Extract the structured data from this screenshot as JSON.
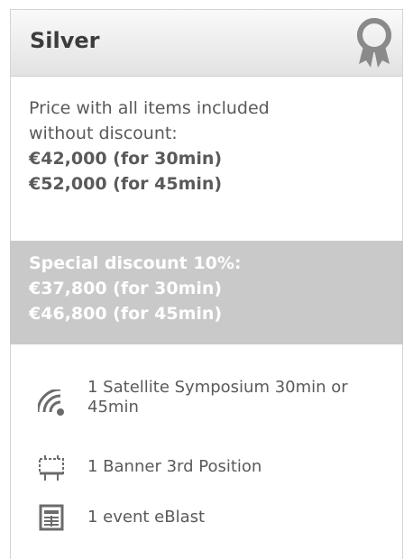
{
  "card": {
    "title": "Silver",
    "badge_icon": "award-ribbon-icon"
  },
  "price": {
    "line1": "Price with all items included",
    "line2": "without discount:",
    "price_30": "€42,000 (for 30min)",
    "price_45": "€52,000 (for 45min)"
  },
  "discount": {
    "heading": "Special discount 10%:",
    "price_30": "€37,800 (for 30min)",
    "price_45": "€46,800 (for 45min)"
  },
  "features": [
    {
      "icon": "wifi-signal-icon",
      "text": "1 Satellite Symposium 30min or 45min"
    },
    {
      "icon": "billboard-icon",
      "text": "1 Banner 3rd Position"
    },
    {
      "icon": "newsletter-icon",
      "text": "1 event eBlast"
    }
  ],
  "colors": {
    "header_bg": "#e6e6e6",
    "discount_bg": "#c9c9c9",
    "text": "#5a5a5a",
    "icon": "#6b6b6b"
  }
}
